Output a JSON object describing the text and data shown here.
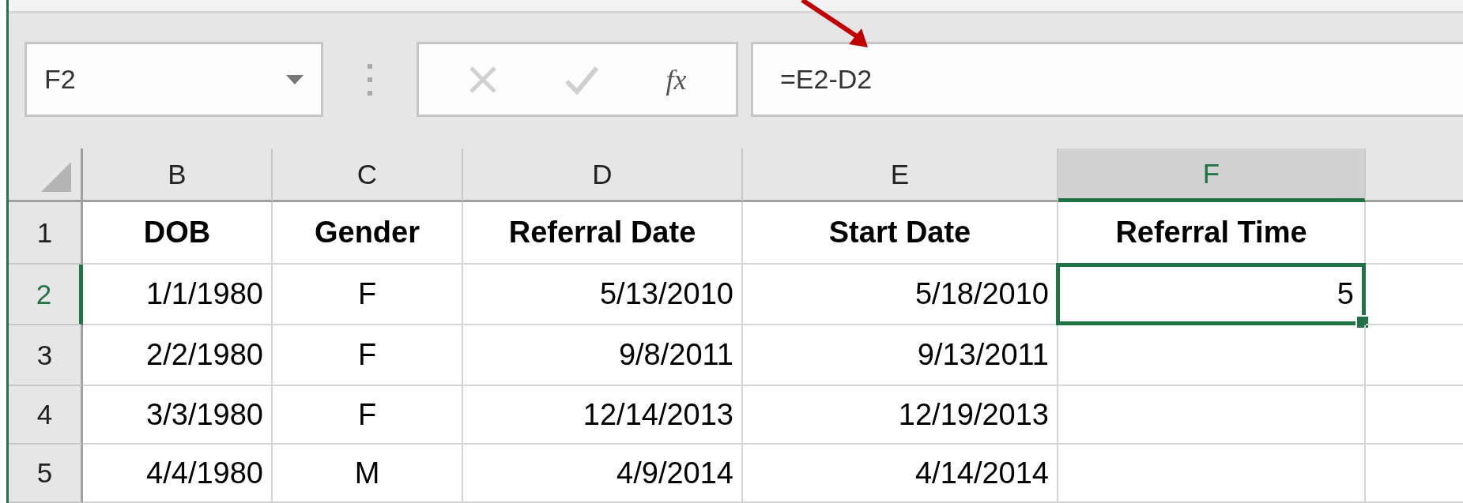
{
  "name_box": {
    "value": "F2"
  },
  "formula_bar": {
    "function_label": "fx",
    "formula": "=E2-D2"
  },
  "columns": [
    {
      "label": "B",
      "selected": false
    },
    {
      "label": "C",
      "selected": false
    },
    {
      "label": "D",
      "selected": false
    },
    {
      "label": "E",
      "selected": false
    },
    {
      "label": "F",
      "selected": true
    }
  ],
  "rows": [
    {
      "number": "1",
      "kind": "header",
      "selected": false,
      "cells": [
        "DOB",
        "Gender",
        "Referral Date",
        "Start Date",
        "Referral Time"
      ]
    },
    {
      "number": "2",
      "kind": "data",
      "selected": true,
      "cells": [
        "1/1/1980",
        "F",
        "5/13/2010",
        "5/18/2010",
        "5"
      ]
    },
    {
      "number": "3",
      "kind": "data",
      "selected": false,
      "cells": [
        "2/2/1980",
        "F",
        "9/8/2011",
        "9/13/2011",
        ""
      ]
    },
    {
      "number": "4",
      "kind": "data",
      "selected": false,
      "cells": [
        "3/3/1980",
        "F",
        "12/14/2013",
        "12/19/2013",
        ""
      ]
    },
    {
      "number": "5",
      "kind": "data",
      "selected": false,
      "cells": [
        "4/4/1980",
        "M",
        "4/9/2014",
        "4/14/2014",
        ""
      ]
    }
  ]
}
